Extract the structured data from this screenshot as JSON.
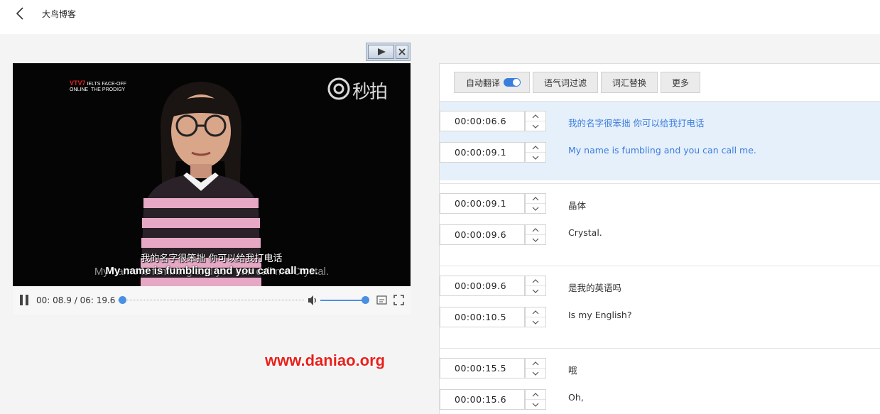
{
  "header": {
    "title": "大鸟博客"
  },
  "player": {
    "channel_logo": {
      "brand": "VTV7",
      "line1": "IELTS FACE-OFF",
      "line2_left": "ONLINE",
      "line2_right": "THE PRODIGY"
    },
    "watermark_text": "秒拍",
    "subtitle_cn": "我的名字很笨拙 你可以给我打电话",
    "subtitle_en": "My name is fumbling and you can call me.",
    "subtitle_en_ghost": "My name is fumbling and you can call me Crystal.",
    "current_time": "00: 08.9",
    "separator": "/",
    "duration": "06: 19.6",
    "progress": 0.023,
    "volume": 1.0
  },
  "site_watermark": "www.daniao.org",
  "toolbar": {
    "auto_translate": "自动翻译",
    "auto_translate_on": true,
    "filler_filter": "语气词过滤",
    "word_replace": "词汇替换",
    "more": "更多"
  },
  "segments": [
    {
      "start": "00:00:06.6",
      "end": "00:00:09.1",
      "cn": "我的名字很笨拙 你可以给我打电话",
      "en": "My name is fumbling and you can call me.",
      "active": true
    },
    {
      "start": "00:00:09.1",
      "end": "00:00:09.6",
      "cn": "晶体",
      "en": "Crystal.",
      "active": false
    },
    {
      "start": "00:00:09.6",
      "end": "00:00:10.5",
      "cn": "是我的英语吗",
      "en": "Is my English?",
      "active": false
    },
    {
      "start": "00:00:15.5",
      "end": "00:00:15.6",
      "cn": "哦",
      "en": "Oh,",
      "active": false
    }
  ],
  "colors": {
    "accent": "#3b7ddd",
    "active_row_bg": "#e6f0fb",
    "watermark_red": "#e8201b"
  }
}
